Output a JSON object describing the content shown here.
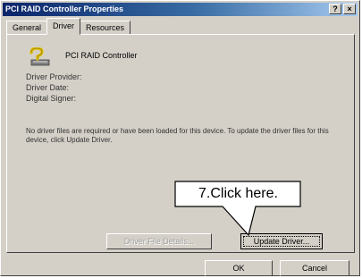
{
  "window": {
    "title": "PCI RAID Controller Properties",
    "help_glyph": "?",
    "close_glyph": "×"
  },
  "tabs": [
    {
      "label": "General",
      "active": false
    },
    {
      "label": "Driver",
      "active": true
    },
    {
      "label": "Resources",
      "active": false
    }
  ],
  "device": {
    "icon": "unknown-device-question-icon",
    "name": "PCI RAID Controller"
  },
  "driver_info": {
    "provider_label": "Driver Provider:",
    "date_label": "Driver Date:",
    "signer_label": "Digital Signer:"
  },
  "description": "No driver files are required or have been loaded for this device. To update the driver files for this device, click Update Driver.",
  "buttons": {
    "driver_details": "Driver File Details...",
    "update_driver": "Update Driver...",
    "ok": "OK",
    "cancel": "Cancel"
  },
  "callout": {
    "text": "7.Click here."
  },
  "colors": {
    "dialog_bg": "#d4d0c8",
    "title_start": "#0a246a",
    "title_end": "#a6caf0"
  }
}
